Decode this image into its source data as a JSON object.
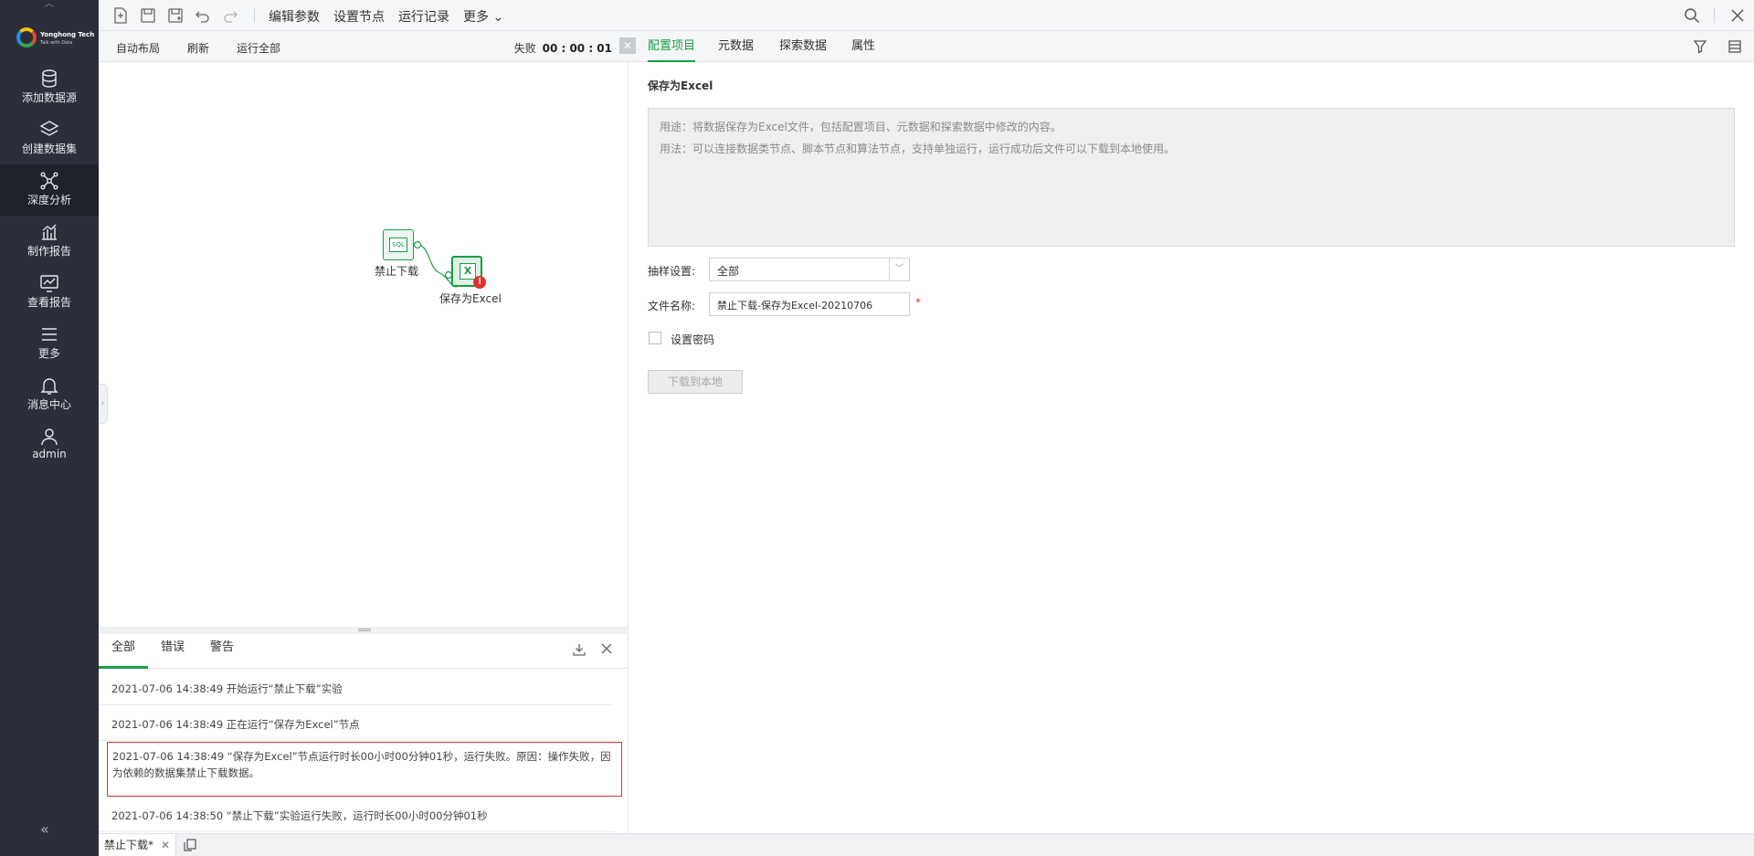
{
  "sidebar": {
    "brand": "Yonghong Tech",
    "slogan": "Talk with Data",
    "items": [
      {
        "label": "添加数据源",
        "icon": "database-icon"
      },
      {
        "label": "创建数据集",
        "icon": "layers-icon"
      },
      {
        "label": "深度分析",
        "icon": "network-icon"
      },
      {
        "label": "制作报告",
        "icon": "chart-icon"
      },
      {
        "label": "查看报告",
        "icon": "monitor-chart-icon"
      },
      {
        "label": "更多",
        "icon": "menu-icon"
      },
      {
        "label": "消息中心",
        "icon": "bell-icon"
      },
      {
        "label": "admin",
        "icon": "user-icon"
      }
    ],
    "active_index": 2,
    "collapse_glyph": "«"
  },
  "toolbar": {
    "menus": [
      "编辑参数",
      "设置节点",
      "运行记录",
      "更多"
    ],
    "more_arrow": "⌄"
  },
  "canvas_toolbar": {
    "auto_layout": "自动布局",
    "refresh": "刷新",
    "run_all": "运行全部",
    "status_label": "失败",
    "status_time": "00 : 00 : 01"
  },
  "nodes": {
    "source_label": "禁止下载",
    "source_badge": "SQL",
    "target_label": "保存为Excel",
    "target_badge": "X",
    "error_badge": "!"
  },
  "log": {
    "tabs": [
      "全部",
      "错误",
      "警告"
    ],
    "active_tab": 0,
    "lines": [
      "2021-07-06 14:38:49 开始运行“禁止下载”实验",
      "2021-07-06 14:38:49 正在运行“保存为Excel”节点",
      "2021-07-06 14:38:49 “保存为Excel”节点运行时长00小时00分钟01秒，运行失败。原因：操作失败，因为依赖的数据集禁止下载数据。",
      "2021-07-06 14:38:50 “禁止下载”实验运行失败，运行时长00小时00分钟01秒"
    ]
  },
  "right_panel": {
    "tabs": [
      "配置项目",
      "元数据",
      "探索数据",
      "属性"
    ],
    "active_tab": 0,
    "title": "保存为Excel",
    "usage": "用途：将数据保存为Excel文件，包括配置项目、元数据和探索数据中修改的内容。",
    "method": "用法：可以连接数据类节点、脚本节点和算法节点，支持单独运行，运行成功后文件可以下载到本地使用。",
    "sampling_label": "抽样设置:",
    "sampling_value": "全部",
    "filename_label": "文件名称:",
    "filename_value": "禁止下载-保存为Excel-20210706",
    "required_mark": "*",
    "password_label": "设置密码",
    "download_button": "下载到本地"
  },
  "bottom_tabs": [
    {
      "label": "禁止下载*"
    }
  ],
  "colors": {
    "accent": "#1a9c46",
    "sidebar_bg": "#2b2f3a",
    "error": "#e0322f"
  }
}
